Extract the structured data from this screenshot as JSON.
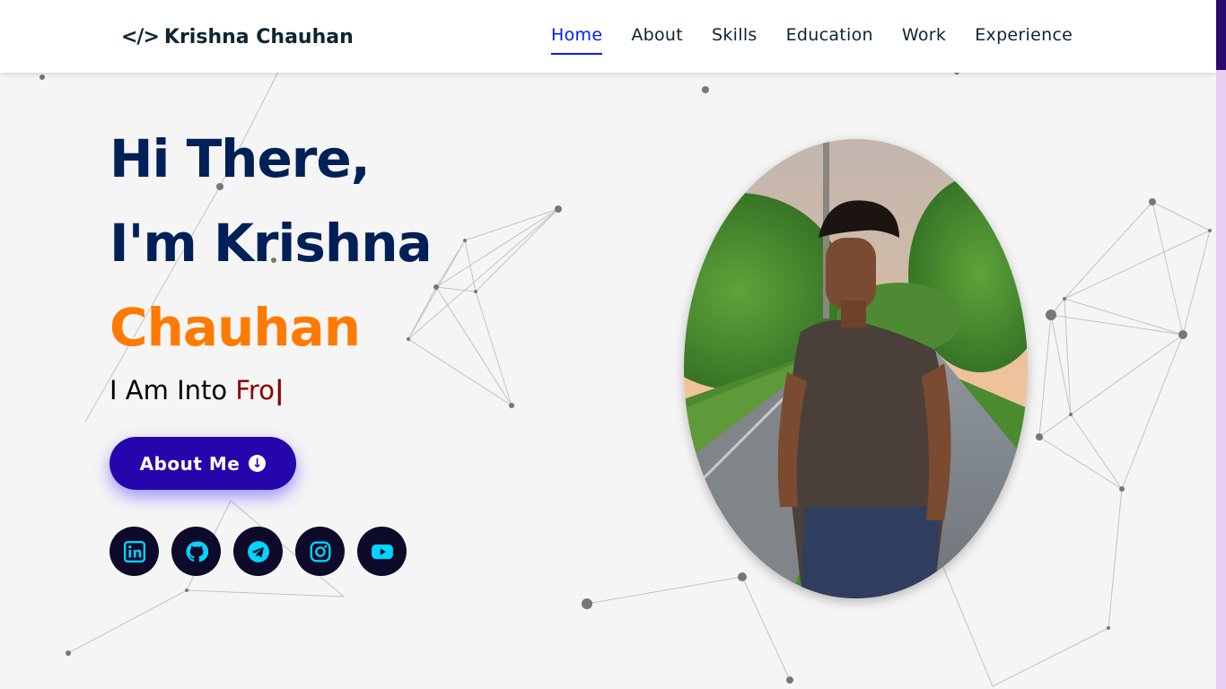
{
  "header": {
    "logo_icon": "</>",
    "logo_text": "Krishna Chauhan",
    "nav": [
      {
        "label": "Home",
        "active": true
      },
      {
        "label": "About"
      },
      {
        "label": "Skills"
      },
      {
        "label": "Education"
      },
      {
        "label": "Work"
      },
      {
        "label": "Experience"
      }
    ]
  },
  "hero": {
    "line1": "Hi There,",
    "line2": "I'm Krishna",
    "line3": "Chauhan",
    "typing_prefix": "I Am Into ",
    "typing_text": "Fro",
    "typing_cursor": "|",
    "button_label": "About Me",
    "button_icon": "arrow-down-circle-icon"
  },
  "socials": [
    {
      "name": "linkedin-icon"
    },
    {
      "name": "github-icon"
    },
    {
      "name": "telegram-icon"
    },
    {
      "name": "instagram-icon"
    },
    {
      "name": "youtube-icon"
    }
  ],
  "colors": {
    "nav_active": "#011aff",
    "heading": "#002057",
    "accent_orange": "#ff7a00",
    "button": "#2506ad",
    "social_bg": "#0e0a2a",
    "social_icon": "#00d4ff",
    "typed_text": "#8b0000"
  }
}
